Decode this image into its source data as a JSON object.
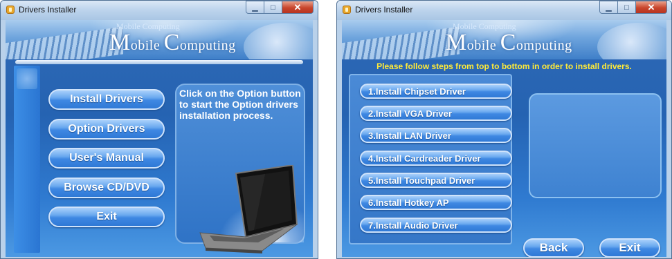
{
  "window1": {
    "title": "Drivers Installer",
    "banner": {
      "subtitle": "Mobile Computing",
      "title_cap1": "M",
      "title_rest1": "obile ",
      "title_cap2": "C",
      "title_rest2": "omputing"
    },
    "buttons": [
      "Install Drivers",
      "Option Drivers",
      "User's Manual",
      "Browse CD/DVD",
      "Exit"
    ],
    "info_text": "Click on the Option button to start the Option drivers installation process."
  },
  "window2": {
    "title": "Drivers Installer",
    "banner": {
      "subtitle": "Mobile Computing",
      "title_cap1": "M",
      "title_rest1": "obile ",
      "title_cap2": "C",
      "title_rest2": "omputing"
    },
    "instruction": "Please follow steps from top to bottom in order to install drivers.",
    "steps": [
      "1.Install Chipset Driver",
      "2.Install VGA Driver",
      "3.Install LAN Driver",
      "4.Install Cardreader Driver",
      "5.Install Touchpad Driver",
      "6.Install Hotkey AP",
      "7.Install Audio Driver"
    ],
    "back_label": "Back",
    "exit_label": "Exit"
  },
  "icons": {
    "app": "app-icon",
    "minimize": "minimize-icon",
    "maximize": "maximize-icon",
    "close": "close-icon"
  },
  "colors": {
    "instruction": "#ffea38",
    "button_top": "#a9d0fb",
    "button_bottom": "#2f79d6",
    "close": "#c8452c"
  }
}
